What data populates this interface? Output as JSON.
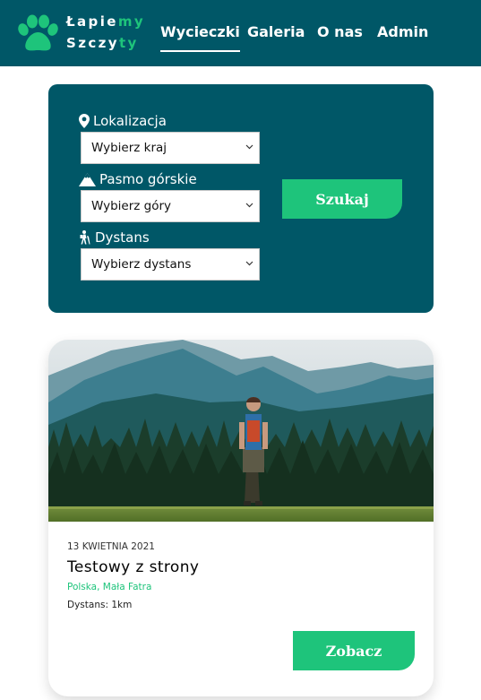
{
  "logo": {
    "line1_plain": "Łapie",
    "line1_accent": "my",
    "line2_plain": "Szczy",
    "line2_accent": "ty",
    "icon": "paw-icon"
  },
  "nav": {
    "items": [
      "Wycieczki",
      "Galeria",
      "O nas",
      "Admin"
    ],
    "active": "Wycieczki"
  },
  "search": {
    "location_label": "Lokalizacja",
    "location_icon": "map-pin-icon",
    "location_value": "Wybierz kraj",
    "range_label": "Pasmo górskie",
    "range_icon": "mountain-icon",
    "range_value": "Wybierz góry",
    "distance_label": "Dystans",
    "distance_icon": "hiker-icon",
    "distance_value": "Wybierz dystans",
    "submit_label": "Szukaj"
  },
  "card": {
    "date": "13 KWIETNIA 2021",
    "title": "Testowy z strony",
    "location": "Polska, Mała Fatra",
    "distance": "Dystans: 1km",
    "button_label": "Zobacz",
    "photo_icon": "mountain-hiker-photo"
  },
  "colors": {
    "primary": "#005767",
    "accent": "#1ec47b",
    "text_dark": "#000000",
    "background": "#ffffff"
  }
}
